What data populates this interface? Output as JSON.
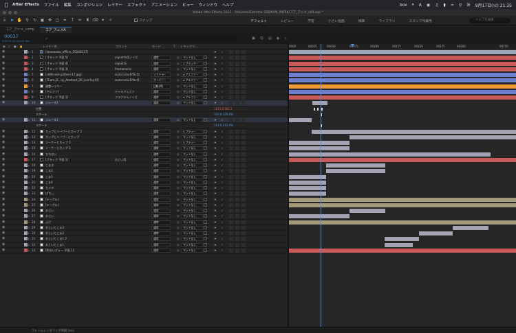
{
  "menubar": {
    "app_name": "After Effects",
    "items": [
      "ファイル",
      "編集",
      "コンポジション",
      "レイヤー",
      "エフェクト",
      "アニメーション",
      "ビュー",
      "ウィンドウ",
      "ヘルプ"
    ],
    "clock": "9月17日(火) 21:35",
    "tray_box": "box",
    "tray_a": "A"
  },
  "window": {
    "title": "Adobe After Effects 2023 - /Volumes/Extreme SSD/KAN_WORK/コア_アニメ_v04.aep *"
  },
  "toolbar": {
    "snap_label": "スナップ",
    "workspaces": [
      "デフォルト",
      "レビュー",
      "学習",
      "小さい画面",
      "標準",
      "ライブラリ",
      "スタンプ作業用"
    ],
    "help_placeholder": "ヘルプを検索"
  },
  "tabs": [
    {
      "label": "コア_アニメ_comp"
    },
    {
      "label": "コア_アニメA"
    }
  ],
  "comp": {
    "timecode": "00037",
    "sub": "0:00:01:13 (24.00 fps)",
    "search_placeholder": "ρ."
  },
  "columns": {
    "name": "レイヤー名",
    "comment": "コメント",
    "mode": "モード",
    "t": "T",
    "matte": "トラックマ..."
  },
  "layers": [
    {
      "num": "1",
      "name": "[komaneko_offline_20240117]",
      "cmt": "",
      "mode": "",
      "matte": "",
      "icon": "fold",
      "color": "#9ea9b8"
    },
    {
      "num": "2",
      "name": "[ブラック 平面 5]",
      "cmt": "vignette用ノイズ",
      "mode": "通常",
      "matte": "マットなし",
      "icon": "dark",
      "color": "#c95a5a"
    },
    {
      "num": "3",
      "name": "[ブラック 平面 4]",
      "cmt": "vignette",
      "mode": "通常",
      "matte": "1.ブラック~",
      "icon": "dark",
      "color": "#c95a5a"
    },
    {
      "num": "4",
      "name": "[ブラック 平面 3]",
      "cmt": "fractalnoise",
      "mode": "通常",
      "matte": "マットなし",
      "icon": "dark",
      "color": "#c95a5a"
    },
    {
      "num": "5",
      "name": "[cd00-ask-pattern-17.jpg]",
      "cmt": "watercolorEffect2",
      "mode": "ソフトラ~",
      "matte": "α アルファ~",
      "icon": "",
      "color": "#6f7fd0"
    },
    {
      "num": "6",
      "name": "[TCam_D...ay_Abstract_2K_overlay.tif]",
      "cmt": "watercolorEffect1",
      "mode": "オーバー~",
      "matte": "α アルファ~",
      "icon": "",
      "color": "#6f7fd0"
    },
    {
      "num": "7",
      "name": "調整レイヤー",
      "cmt": "",
      "mode": "比較(明)",
      "matte": "マットなし",
      "icon": "",
      "color": "#ef9a3a"
    },
    {
      "num": "8",
      "name": "[アルファ]",
      "cmt": "キャラアルファ",
      "mode": "通常",
      "matte": "マットなし",
      "icon": "",
      "color": "#6f7fd0"
    },
    {
      "num": "9",
      "name": "[ブラック 平面 1]",
      "cmt": "フラクタルノイズ",
      "mode": "通常",
      "matte": "α アルファ~",
      "icon": "dark",
      "color": "#c95a5a"
    },
    {
      "num": "10",
      "name": "ジュース2",
      "cmt": "",
      "mode": "通常",
      "matte": "マットなし",
      "icon": "",
      "color": "#a3a3b3"
    },
    {
      "prop": "位置",
      "val": "1073.0,582.2",
      "valcolor": "red"
    },
    {
      "prop": "スケール",
      "val": "120.0,120.0%",
      "valcolor": "blue"
    },
    {
      "num": "11",
      "name": "ジュース1",
      "cmt": "",
      "mode": "通常",
      "matte": "マットなし",
      "icon": "",
      "color": "#a3a3b3"
    },
    {
      "prop": "スケール",
      "val": "113.0,113.0%",
      "valcolor": "blue"
    },
    {
      "num": "12",
      "name": "カップとソーサーとカップ 2",
      "cmt": "",
      "mode": "通常",
      "matte": "4.ブラッ~",
      "icon": "",
      "color": "#a3a3b3"
    },
    {
      "num": "13",
      "name": "カップとソーサーとカップ",
      "cmt": "",
      "mode": "通常",
      "matte": "マットなし",
      "icon": "",
      "color": "#a3a3b3"
    },
    {
      "num": "14",
      "name": "ソーサーとカップ 3",
      "cmt": "",
      "mode": "通常",
      "matte": "4.ブラッ~",
      "icon": "",
      "color": "#a3a3b3"
    },
    {
      "num": "15",
      "name": "ソーサーとカップ 2",
      "cmt": "",
      "mode": "通常",
      "matte": "マットなし",
      "icon": "",
      "color": "#a3a3b3"
    },
    {
      "num": "16",
      "name": "ちちはい",
      "cmt": "",
      "mode": "通常",
      "matte": "マットなし",
      "icon": "",
      "color": "#a3a3b3"
    },
    {
      "num": "17",
      "name": "[ブラック 平面 1]",
      "cmt": "おじい用",
      "mode": "通常",
      "matte": "マットなし",
      "icon": "dark",
      "color": "#c95a5a"
    },
    {
      "num": "18",
      "name": "こまき",
      "cmt": "",
      "mode": "通常",
      "matte": "マットなし",
      "icon": "",
      "color": "#a3a3b3"
    },
    {
      "num": "19",
      "name": "こま2",
      "cmt": "",
      "mode": "通常",
      "matte": "マットなし",
      "icon": "",
      "color": "#a3a3b3"
    },
    {
      "num": "20",
      "name": "こま5",
      "cmt": "",
      "mode": "通常",
      "matte": "マットなし",
      "icon": "",
      "color": "#a3a3b3"
    },
    {
      "num": "21",
      "name": "こま4",
      "cmt": "",
      "mode": "通常",
      "matte": "マットなし",
      "icon": "",
      "color": "#a3a3b3"
    },
    {
      "num": "22",
      "name": "カメラ",
      "cmt": "",
      "mode": "通常",
      "matte": "マットなし",
      "icon": "",
      "color": "#a3a3b3"
    },
    {
      "num": "23",
      "name": "ぱちし",
      "cmt": "",
      "mode": "通常",
      "matte": "マットなし",
      "icon": "",
      "color": "#a3a3b3"
    },
    {
      "num": "24",
      "name": "[テーブル]",
      "cmt": "",
      "mode": "通常",
      "matte": "マットなし",
      "icon": "",
      "color": "#a39a7a"
    },
    {
      "num": "25",
      "name": "[テーブル]",
      "cmt": "",
      "mode": "通常",
      "matte": "マットなし",
      "icon": "",
      "color": "#a39a7a"
    },
    {
      "num": "26",
      "name": "おじい",
      "cmt": "",
      "mode": "通常",
      "matte": "マットなし",
      "icon": "",
      "color": "#a3a3b3"
    },
    {
      "num": "27",
      "name": "おじい",
      "cmt": "",
      "mode": "通常",
      "matte": "マットなし",
      "icon": "",
      "color": "#a3a3b3"
    },
    {
      "num": "28",
      "name": "ふげ",
      "cmt": "",
      "mode": "通常",
      "matte": "マットなし",
      "icon": "",
      "color": "#a39a7a"
    },
    {
      "num": "29",
      "name": "おじいとこま3",
      "cmt": "",
      "mode": "通常",
      "matte": "マットなし",
      "icon": "",
      "color": "#a3a3b3"
    },
    {
      "num": "30",
      "name": "おじいとこま2",
      "cmt": "",
      "mode": "通常",
      "matte": "マットなし",
      "icon": "",
      "color": "#a3a3b3"
    },
    {
      "num": "31",
      "name": "おじいとこま1 2",
      "cmt": "",
      "mode": "通常",
      "matte": "マットなし",
      "icon": "",
      "color": "#a3a3b3"
    },
    {
      "num": "32",
      "name": "おじいとこま1",
      "cmt": "",
      "mode": "通常",
      "matte": "マットなし",
      "icon": "",
      "color": "#a3a3b3"
    },
    {
      "num": "33",
      "name": "[明るいグレー 平面 1]",
      "cmt": "",
      "mode": "通常",
      "matte": "マットなし",
      "icon": "",
      "color": "#c95a5a"
    }
  ],
  "ruler": {
    "labels": [
      "0000",
      "00025",
      "00050",
      "00075",
      "00100",
      "00125",
      "00150",
      "00175",
      "00200",
      "00250"
    ]
  },
  "footer": {
    "label": "フレームレンダリング時間",
    "value": "0ms"
  }
}
